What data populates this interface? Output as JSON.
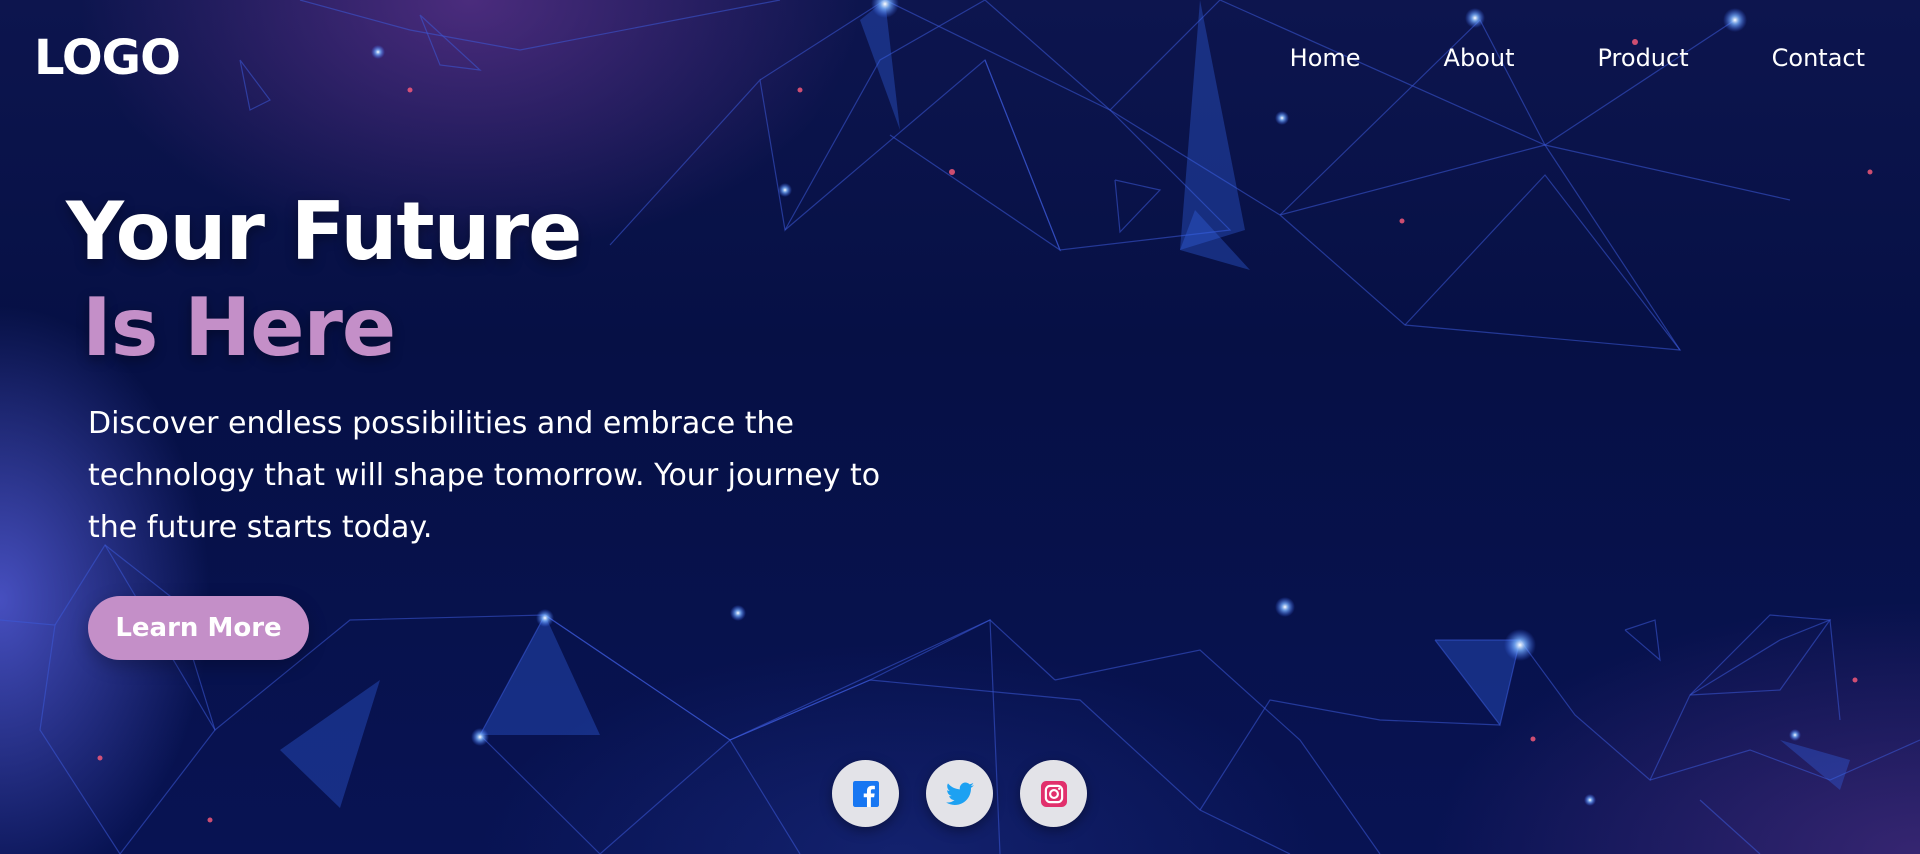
{
  "header": {
    "logo": "LOGO",
    "nav": [
      {
        "label": "Home"
      },
      {
        "label": "About"
      },
      {
        "label": "Product"
      },
      {
        "label": "Contact"
      }
    ]
  },
  "hero": {
    "title_line1": "Your Future",
    "title_line2": "Is Here",
    "description": "Discover endless possibilities and embrace the technology that will shape tomorrow. Your journey to the future starts today.",
    "cta_label": "Learn More"
  },
  "social": [
    {
      "icon": "facebook-icon",
      "color": "#1877f2"
    },
    {
      "icon": "twitter-icon",
      "color": "#1da1f2"
    },
    {
      "icon": "instagram-icon",
      "color": "#e1306c"
    }
  ],
  "colors": {
    "background": "#07103f",
    "accent": "#c48fc8",
    "text": "#ffffff",
    "social_button": "#e3e3e8"
  }
}
